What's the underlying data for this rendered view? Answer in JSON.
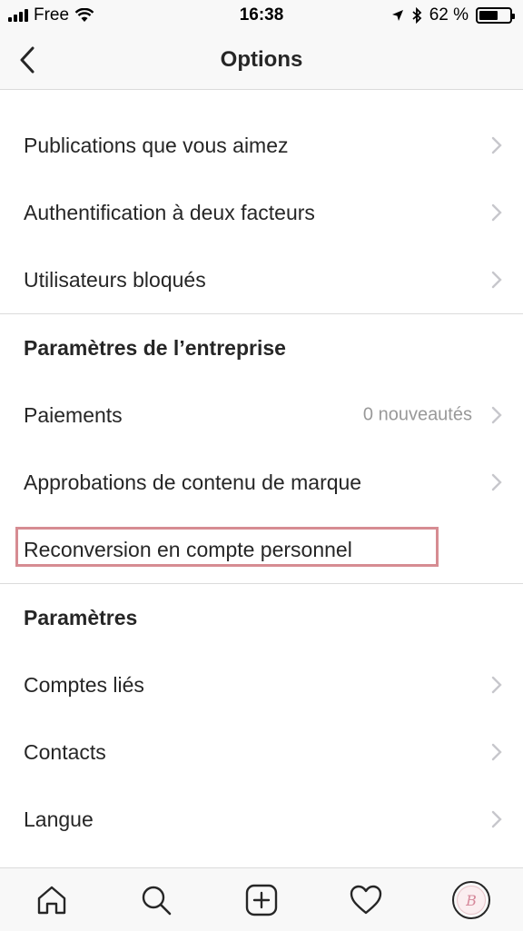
{
  "status_bar": {
    "carrier": "Free",
    "time": "16:38",
    "battery_text": "62 %",
    "battery_level": 0.62
  },
  "nav": {
    "title": "Options",
    "back_icon": "chevron-left-icon"
  },
  "list": {
    "top_rows": [
      {
        "label": "Publications que vous aimez"
      },
      {
        "label": "Authentification à deux facteurs"
      },
      {
        "label": "Utilisateurs bloqués"
      }
    ],
    "business_section": {
      "header": "Paramètres de l’entreprise",
      "payments": {
        "label": "Paiements",
        "subtext": "0 nouveautés"
      },
      "branded_content": {
        "label": "Approbations de contenu de marque"
      },
      "convert_personal": {
        "label": "Reconversion en compte personnel"
      }
    },
    "settings_section": {
      "header": "Paramètres",
      "rows": [
        {
          "label": "Comptes liés"
        },
        {
          "label": "Contacts"
        },
        {
          "label": "Langue"
        }
      ]
    }
  },
  "tab_bar": {
    "tabs": [
      "home-icon",
      "search-icon",
      "new-post-icon",
      "activity-heart-icon",
      "profile-avatar"
    ],
    "avatar_letter": "B"
  },
  "colors": {
    "highlight": "#d68c92",
    "secondary_text": "#999999",
    "separator": "#dbdbdb"
  }
}
